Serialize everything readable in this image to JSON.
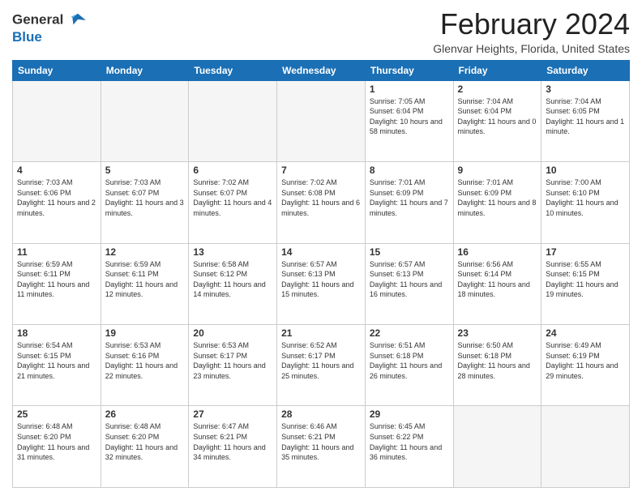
{
  "header": {
    "logo_line1": "General",
    "logo_line2": "Blue",
    "title": "February 2024",
    "subtitle": "Glenvar Heights, Florida, United States"
  },
  "columns": [
    "Sunday",
    "Monday",
    "Tuesday",
    "Wednesday",
    "Thursday",
    "Friday",
    "Saturday"
  ],
  "weeks": [
    [
      {
        "num": "",
        "info": "",
        "empty": true
      },
      {
        "num": "",
        "info": "",
        "empty": true
      },
      {
        "num": "",
        "info": "",
        "empty": true
      },
      {
        "num": "",
        "info": "",
        "empty": true
      },
      {
        "num": "1",
        "info": "Sunrise: 7:05 AM\nSunset: 6:04 PM\nDaylight: 10 hours\nand 58 minutes.",
        "empty": false
      },
      {
        "num": "2",
        "info": "Sunrise: 7:04 AM\nSunset: 6:04 PM\nDaylight: 11 hours\nand 0 minutes.",
        "empty": false
      },
      {
        "num": "3",
        "info": "Sunrise: 7:04 AM\nSunset: 6:05 PM\nDaylight: 11 hours\nand 1 minute.",
        "empty": false
      }
    ],
    [
      {
        "num": "4",
        "info": "Sunrise: 7:03 AM\nSunset: 6:06 PM\nDaylight: 11 hours\nand 2 minutes.",
        "empty": false
      },
      {
        "num": "5",
        "info": "Sunrise: 7:03 AM\nSunset: 6:07 PM\nDaylight: 11 hours\nand 3 minutes.",
        "empty": false
      },
      {
        "num": "6",
        "info": "Sunrise: 7:02 AM\nSunset: 6:07 PM\nDaylight: 11 hours\nand 4 minutes.",
        "empty": false
      },
      {
        "num": "7",
        "info": "Sunrise: 7:02 AM\nSunset: 6:08 PM\nDaylight: 11 hours\nand 6 minutes.",
        "empty": false
      },
      {
        "num": "8",
        "info": "Sunrise: 7:01 AM\nSunset: 6:09 PM\nDaylight: 11 hours\nand 7 minutes.",
        "empty": false
      },
      {
        "num": "9",
        "info": "Sunrise: 7:01 AM\nSunset: 6:09 PM\nDaylight: 11 hours\nand 8 minutes.",
        "empty": false
      },
      {
        "num": "10",
        "info": "Sunrise: 7:00 AM\nSunset: 6:10 PM\nDaylight: 11 hours\nand 10 minutes.",
        "empty": false
      }
    ],
    [
      {
        "num": "11",
        "info": "Sunrise: 6:59 AM\nSunset: 6:11 PM\nDaylight: 11 hours\nand 11 minutes.",
        "empty": false
      },
      {
        "num": "12",
        "info": "Sunrise: 6:59 AM\nSunset: 6:11 PM\nDaylight: 11 hours\nand 12 minutes.",
        "empty": false
      },
      {
        "num": "13",
        "info": "Sunrise: 6:58 AM\nSunset: 6:12 PM\nDaylight: 11 hours\nand 14 minutes.",
        "empty": false
      },
      {
        "num": "14",
        "info": "Sunrise: 6:57 AM\nSunset: 6:13 PM\nDaylight: 11 hours\nand 15 minutes.",
        "empty": false
      },
      {
        "num": "15",
        "info": "Sunrise: 6:57 AM\nSunset: 6:13 PM\nDaylight: 11 hours\nand 16 minutes.",
        "empty": false
      },
      {
        "num": "16",
        "info": "Sunrise: 6:56 AM\nSunset: 6:14 PM\nDaylight: 11 hours\nand 18 minutes.",
        "empty": false
      },
      {
        "num": "17",
        "info": "Sunrise: 6:55 AM\nSunset: 6:15 PM\nDaylight: 11 hours\nand 19 minutes.",
        "empty": false
      }
    ],
    [
      {
        "num": "18",
        "info": "Sunrise: 6:54 AM\nSunset: 6:15 PM\nDaylight: 11 hours\nand 21 minutes.",
        "empty": false
      },
      {
        "num": "19",
        "info": "Sunrise: 6:53 AM\nSunset: 6:16 PM\nDaylight: 11 hours\nand 22 minutes.",
        "empty": false
      },
      {
        "num": "20",
        "info": "Sunrise: 6:53 AM\nSunset: 6:17 PM\nDaylight: 11 hours\nand 23 minutes.",
        "empty": false
      },
      {
        "num": "21",
        "info": "Sunrise: 6:52 AM\nSunset: 6:17 PM\nDaylight: 11 hours\nand 25 minutes.",
        "empty": false
      },
      {
        "num": "22",
        "info": "Sunrise: 6:51 AM\nSunset: 6:18 PM\nDaylight: 11 hours\nand 26 minutes.",
        "empty": false
      },
      {
        "num": "23",
        "info": "Sunrise: 6:50 AM\nSunset: 6:18 PM\nDaylight: 11 hours\nand 28 minutes.",
        "empty": false
      },
      {
        "num": "24",
        "info": "Sunrise: 6:49 AM\nSunset: 6:19 PM\nDaylight: 11 hours\nand 29 minutes.",
        "empty": false
      }
    ],
    [
      {
        "num": "25",
        "info": "Sunrise: 6:48 AM\nSunset: 6:20 PM\nDaylight: 11 hours\nand 31 minutes.",
        "empty": false
      },
      {
        "num": "26",
        "info": "Sunrise: 6:48 AM\nSunset: 6:20 PM\nDaylight: 11 hours\nand 32 minutes.",
        "empty": false
      },
      {
        "num": "27",
        "info": "Sunrise: 6:47 AM\nSunset: 6:21 PM\nDaylight: 11 hours\nand 34 minutes.",
        "empty": false
      },
      {
        "num": "28",
        "info": "Sunrise: 6:46 AM\nSunset: 6:21 PM\nDaylight: 11 hours\nand 35 minutes.",
        "empty": false
      },
      {
        "num": "29",
        "info": "Sunrise: 6:45 AM\nSunset: 6:22 PM\nDaylight: 11 hours\nand 36 minutes.",
        "empty": false
      },
      {
        "num": "",
        "info": "",
        "empty": true
      },
      {
        "num": "",
        "info": "",
        "empty": true
      }
    ]
  ]
}
